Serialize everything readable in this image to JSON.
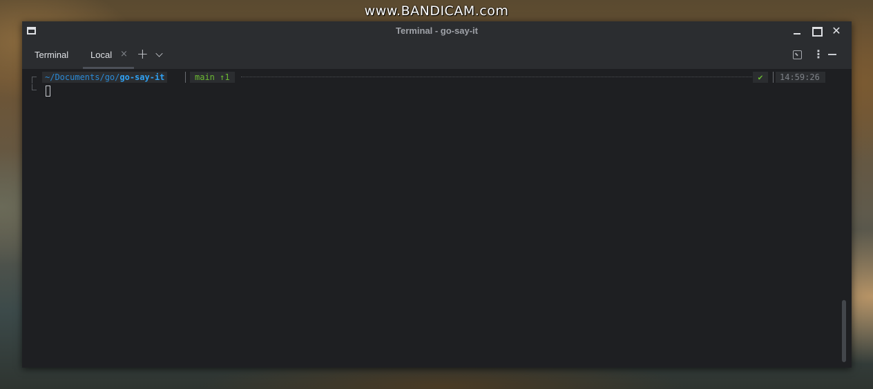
{
  "watermark": "www.BANDICAM.com",
  "window": {
    "title": "Terminal - go-say-it",
    "icons": {
      "app": "terminal-window-icon",
      "minimize": "minimize-icon",
      "maximize": "maximize-icon",
      "close": "close-icon"
    },
    "close_glyph": "✕"
  },
  "toolbar": {
    "title": "Terminal",
    "tabs": [
      {
        "label": "Local",
        "close_glyph": "×"
      }
    ],
    "add_glyph": "+",
    "icons": {
      "add": "plus-icon",
      "tab_menu": "chevron-down-icon",
      "restore": "restore-icon",
      "options": "more-vertical-icon",
      "hide": "hide-icon"
    },
    "kebab_glyph": "⋮"
  },
  "terminal": {
    "path_prefix": "~/Documents/go/",
    "path_current": "go-say-it",
    "git": "main ↑1",
    "status": "✔",
    "time": "14:59:26"
  },
  "colors": {
    "path": "#2b8ad6",
    "git": "#6bbb32",
    "background": "#1e1f22",
    "chrome": "#2b2d30"
  }
}
